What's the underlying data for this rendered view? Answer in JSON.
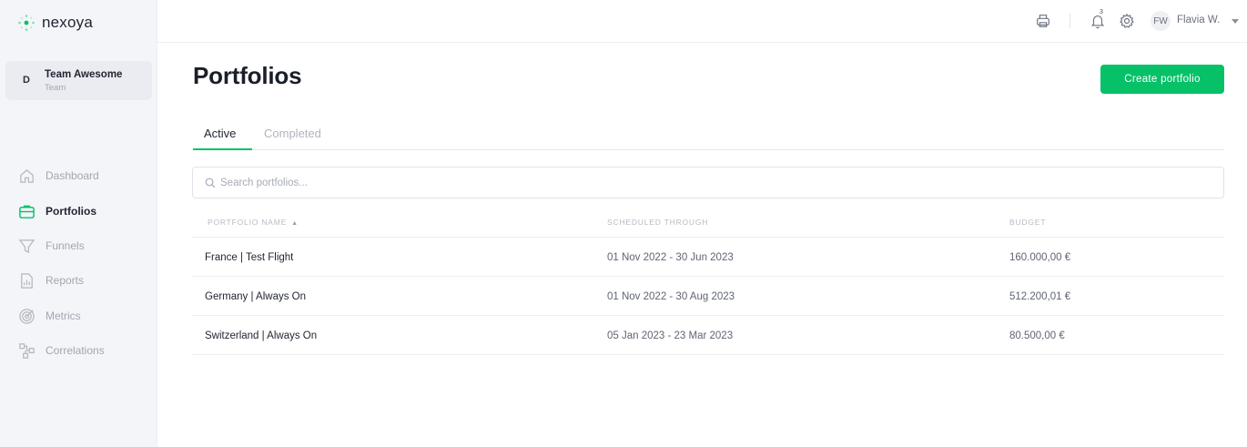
{
  "brand": {
    "name": "nexoya",
    "accent": "#06c167"
  },
  "team": {
    "initial": "D",
    "name": "Team Awesome",
    "subtitle": "Team"
  },
  "sidebar": {
    "items": [
      {
        "label": "Dashboard",
        "icon": "home-icon",
        "active": false
      },
      {
        "label": "Portfolios",
        "icon": "briefcase-icon",
        "active": true
      },
      {
        "label": "Funnels",
        "icon": "funnel-icon",
        "active": false
      },
      {
        "label": "Reports",
        "icon": "report-icon",
        "active": false
      },
      {
        "label": "Metrics",
        "icon": "metrics-icon",
        "active": false
      },
      {
        "label": "Correlations",
        "icon": "correlations-icon",
        "active": false
      }
    ]
  },
  "topbar": {
    "notification_count": "3",
    "user_initials": "FW",
    "user_name": "Flavia W."
  },
  "page": {
    "title": "Portfolios",
    "create_label": "Create portfolio",
    "tabs": [
      {
        "label": "Active",
        "active": true
      },
      {
        "label": "Completed",
        "active": false
      }
    ],
    "search_placeholder": "Search portfolios..."
  },
  "table": {
    "headers": {
      "name": "PORTFOLIO NAME",
      "scheduled": "SCHEDULED THROUGH",
      "budget": "BUDGET"
    },
    "rows": [
      {
        "name": "France | Test Flight",
        "scheduled": "01 Nov 2022 - 30 Jun 2023",
        "budget": "160.000,00 €"
      },
      {
        "name": "Germany | Always On",
        "scheduled": "01 Nov 2022 - 30 Aug 2023",
        "budget": "512.200,01 €"
      },
      {
        "name": "Switzerland | Always On",
        "scheduled": "05 Jan 2023 - 23 Mar 2023",
        "budget": "80.500,00 €"
      }
    ]
  }
}
